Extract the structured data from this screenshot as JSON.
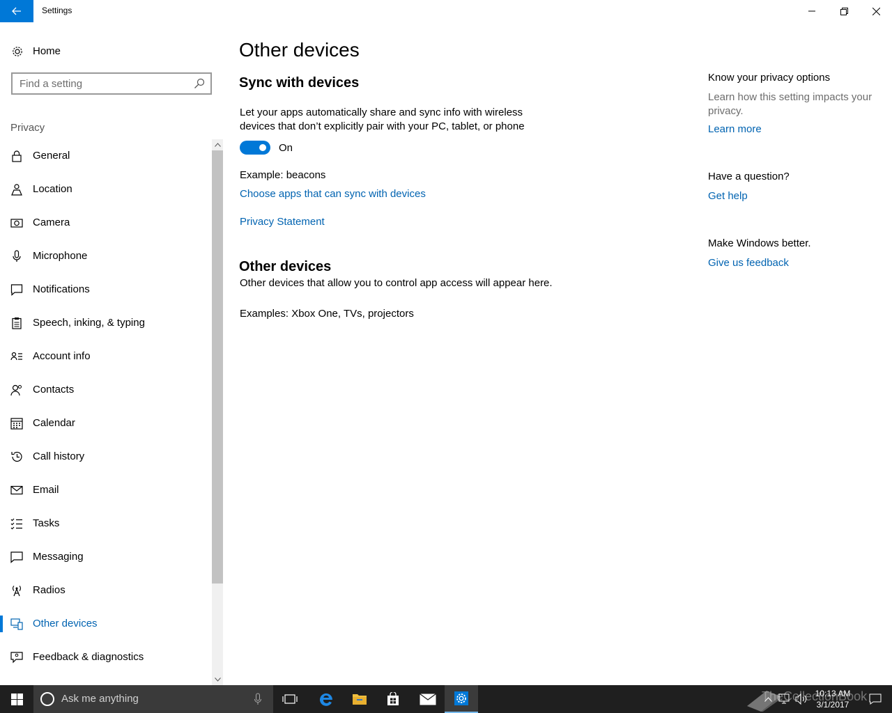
{
  "window": {
    "title": "Settings"
  },
  "sidebar": {
    "home_label": "Home",
    "search_placeholder": "Find a setting",
    "section_label": "Privacy",
    "items": [
      {
        "label": "General",
        "icon": "lock-icon"
      },
      {
        "label": "Location",
        "icon": "location-person-icon"
      },
      {
        "label": "Camera",
        "icon": "camera-icon"
      },
      {
        "label": "Microphone",
        "icon": "microphone-icon"
      },
      {
        "label": "Notifications",
        "icon": "notification-icon"
      },
      {
        "label": "Speech, inking, & typing",
        "icon": "clipboard-icon"
      },
      {
        "label": "Account info",
        "icon": "account-info-icon"
      },
      {
        "label": "Contacts",
        "icon": "contacts-icon"
      },
      {
        "label": "Calendar",
        "icon": "calendar-icon"
      },
      {
        "label": "Call history",
        "icon": "history-icon"
      },
      {
        "label": "Email",
        "icon": "mail-icon"
      },
      {
        "label": "Tasks",
        "icon": "tasks-icon"
      },
      {
        "label": "Messaging",
        "icon": "message-icon"
      },
      {
        "label": "Radios",
        "icon": "radio-tower-icon"
      },
      {
        "label": "Other devices",
        "icon": "devices-icon",
        "active": true
      },
      {
        "label": "Feedback & diagnostics",
        "icon": "feedback-icon"
      }
    ]
  },
  "main": {
    "title": "Other devices",
    "sync_heading": "Sync with devices",
    "sync_desc_line1": "Let your apps automatically share and sync info with wireless",
    "sync_desc_line2": "devices that don’t explicitly pair with your PC, tablet, or phone",
    "toggle_state": "On",
    "toggle_on": true,
    "example_beacons": "Example: beacons",
    "choose_apps_link": "Choose apps that can sync with devices",
    "privacy_statement_link": "Privacy Statement",
    "other_heading": "Other devices",
    "other_desc": "Other devices that allow you to control app access will appear here.",
    "other_examples": "Examples: Xbox One, TVs, projectors"
  },
  "right": {
    "privacy_heading": "Know your privacy options",
    "privacy_text": "Learn how this setting impacts your privacy.",
    "learn_more": "Learn more",
    "question_heading": "Have a question?",
    "get_help": "Get help",
    "better_heading": "Make Windows better.",
    "feedback_link": "Give us feedback"
  },
  "taskbar": {
    "search_placeholder": "Ask me anything",
    "time": "10:13 AM",
    "date": "3/1/2017",
    "watermark": "TheCollectionBook"
  },
  "colors": {
    "accent": "#0078d7",
    "link": "#0063b1",
    "taskbar": "#1f1f1f"
  }
}
